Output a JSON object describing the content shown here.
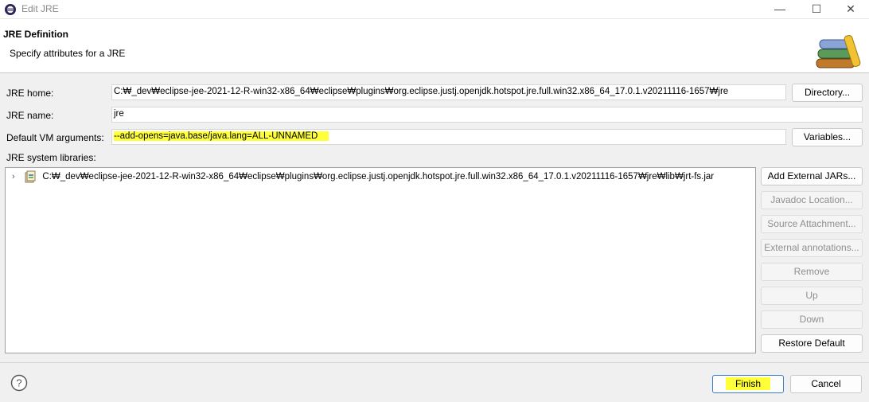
{
  "window": {
    "title": "Edit JRE",
    "controls": {
      "minimize": "—",
      "maximize": "☐",
      "close": "✕"
    }
  },
  "header": {
    "title": "JRE Definition",
    "subtitle": "Specify attributes for a JRE"
  },
  "form": {
    "jre_home_label": "JRE home:",
    "jre_home_value": "C:₩_dev₩eclipse-jee-2021-12-R-win32-x86_64₩eclipse₩plugins₩org.eclipse.justj.openjdk.hotspot.jre.full.win32.x86_64_17.0.1.v20211116-1657₩jre",
    "directory_button": "Directory...",
    "jre_name_label": "JRE name:",
    "jre_name_value": "jre",
    "vm_args_label": "Default VM arguments:",
    "vm_args_value": "--add-opens=java.base/java.lang=ALL-UNNAMED",
    "variables_button": "Variables...",
    "libraries_label": "JRE system libraries:"
  },
  "libraries": [
    {
      "path": "C:₩_dev₩eclipse-jee-2021-12-R-win32-x86_64₩eclipse₩plugins₩org.eclipse.justj.openjdk.hotspot.jre.full.win32.x86_64_17.0.1.v20211116-1657₩jre₩lib₩jrt-fs.jar",
      "expand_icon": "chevron-right-icon",
      "icon": "jar-file-icon"
    }
  ],
  "side_buttons": {
    "add_external_jars": "Add External JARs...",
    "javadoc_location": "Javadoc Location...",
    "source_attachment": "Source Attachment...",
    "external_annotations": "External annotations...",
    "remove": "Remove",
    "up": "Up",
    "down": "Down",
    "restore_default": "Restore Default"
  },
  "footer": {
    "finish": "Finish",
    "cancel": "Cancel",
    "help_icon": "help-icon"
  },
  "colors": {
    "highlight": "#ffff3a",
    "primary_border": "#3d7cc9",
    "disabled_text": "#8f8f8f"
  }
}
